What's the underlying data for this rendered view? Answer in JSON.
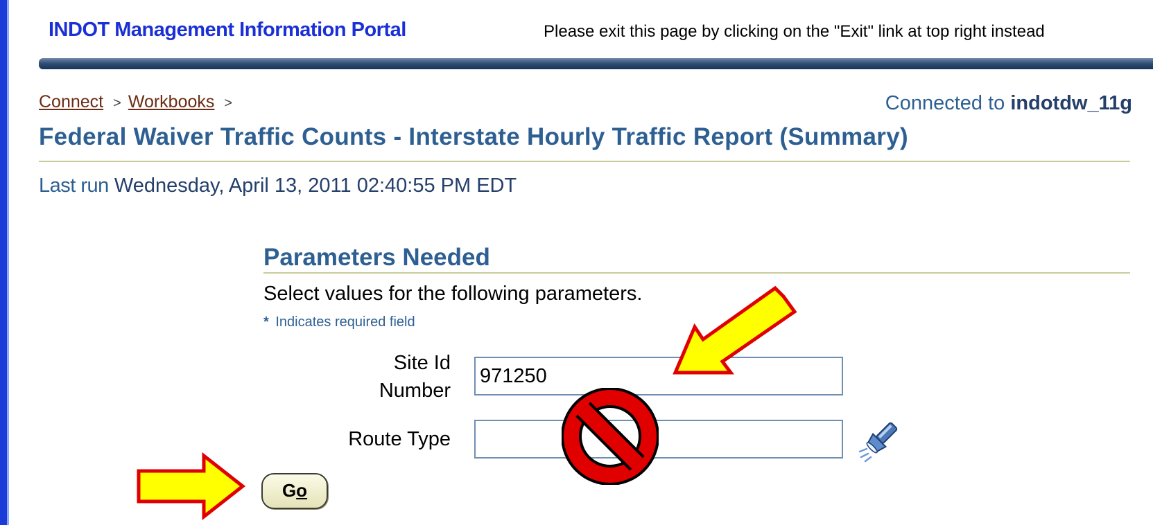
{
  "header": {
    "portal_title": "INDOT Management Information Portal",
    "exit_message": "Please exit this page by clicking on the \"Exit\" link at top right instead"
  },
  "breadcrumb": {
    "items": [
      "Connect",
      "Workbooks"
    ],
    "separator": ">"
  },
  "connection": {
    "prefix": "Connected to",
    "database": "indotdw_11g"
  },
  "report": {
    "title": "Federal Waiver Traffic Counts - Interstate Hourly Traffic Report (Summary)",
    "last_run_label": "Last run",
    "last_run_value": "Wednesday, April 13, 2011 02:40:55 PM EDT"
  },
  "parameters": {
    "title": "Parameters Needed",
    "description": "Select values for the following parameters.",
    "required_marker": "*",
    "required_note": "Indicates required field",
    "fields": [
      {
        "label": "Site Id Number",
        "value": "971250"
      },
      {
        "label": "Route Type",
        "value": ""
      }
    ],
    "go_label_prefix": "G",
    "go_label_access": "o"
  },
  "colors": {
    "portal_blue": "#1a2fd6",
    "heading_blue": "#2d5f92",
    "annotation_arrow": "#ffff00",
    "annotation_outline": "#e00000",
    "no_symbol": "#e00000"
  },
  "icons": {
    "route_type_search": "flashlight-icon",
    "annotation_arrow": "arrow-icon",
    "no_symbol": "prohibited-icon"
  }
}
